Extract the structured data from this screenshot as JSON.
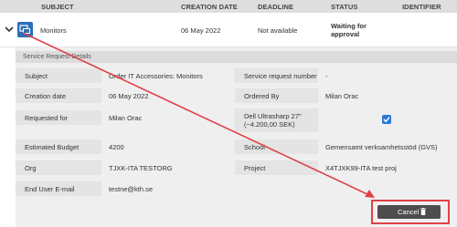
{
  "header": {
    "subject": "SUBJECT",
    "creation_date": "CREATION DATE",
    "deadline": "DEADLINE",
    "status": "STATUS",
    "identifier": "IDENTIFIER"
  },
  "row": {
    "subject": "Monitors",
    "creation_date": "06 May 2022",
    "deadline": "Not available",
    "status": "Waiting for approval"
  },
  "panel": {
    "title": "Service Request Details",
    "fields": [
      {
        "label": "Subject",
        "value": "Order IT Accessories: Monitors"
      },
      {
        "label": "Service request number",
        "value": "-"
      },
      {
        "label": "Creation date",
        "value": "06 May 2022"
      },
      {
        "label": "Ordered By",
        "value": "Milan Orac"
      },
      {
        "label": "Requested for",
        "value": "Milan Orac"
      },
      {
        "label": "Dell Ultrasharp 27\" (~4.200,00 SEK)",
        "value": "checked"
      },
      {
        "label": "Estimated Budget",
        "value": "4200"
      },
      {
        "label": "School",
        "value": "Gemensamt verksamhetsstöd (GVS)"
      },
      {
        "label": "Org",
        "value": "TJXK-ITA TESTORG"
      },
      {
        "label": "Project",
        "value": "X4TJXK99-ITA test proj"
      },
      {
        "label": "End User E-mail",
        "value": "testne@kth.se"
      }
    ]
  },
  "cancel_button": {
    "label": "Cancel"
  },
  "colors": {
    "annotation": "#e0404a",
    "checkbox": "#2b79d6",
    "button": "#4d4d4d"
  }
}
